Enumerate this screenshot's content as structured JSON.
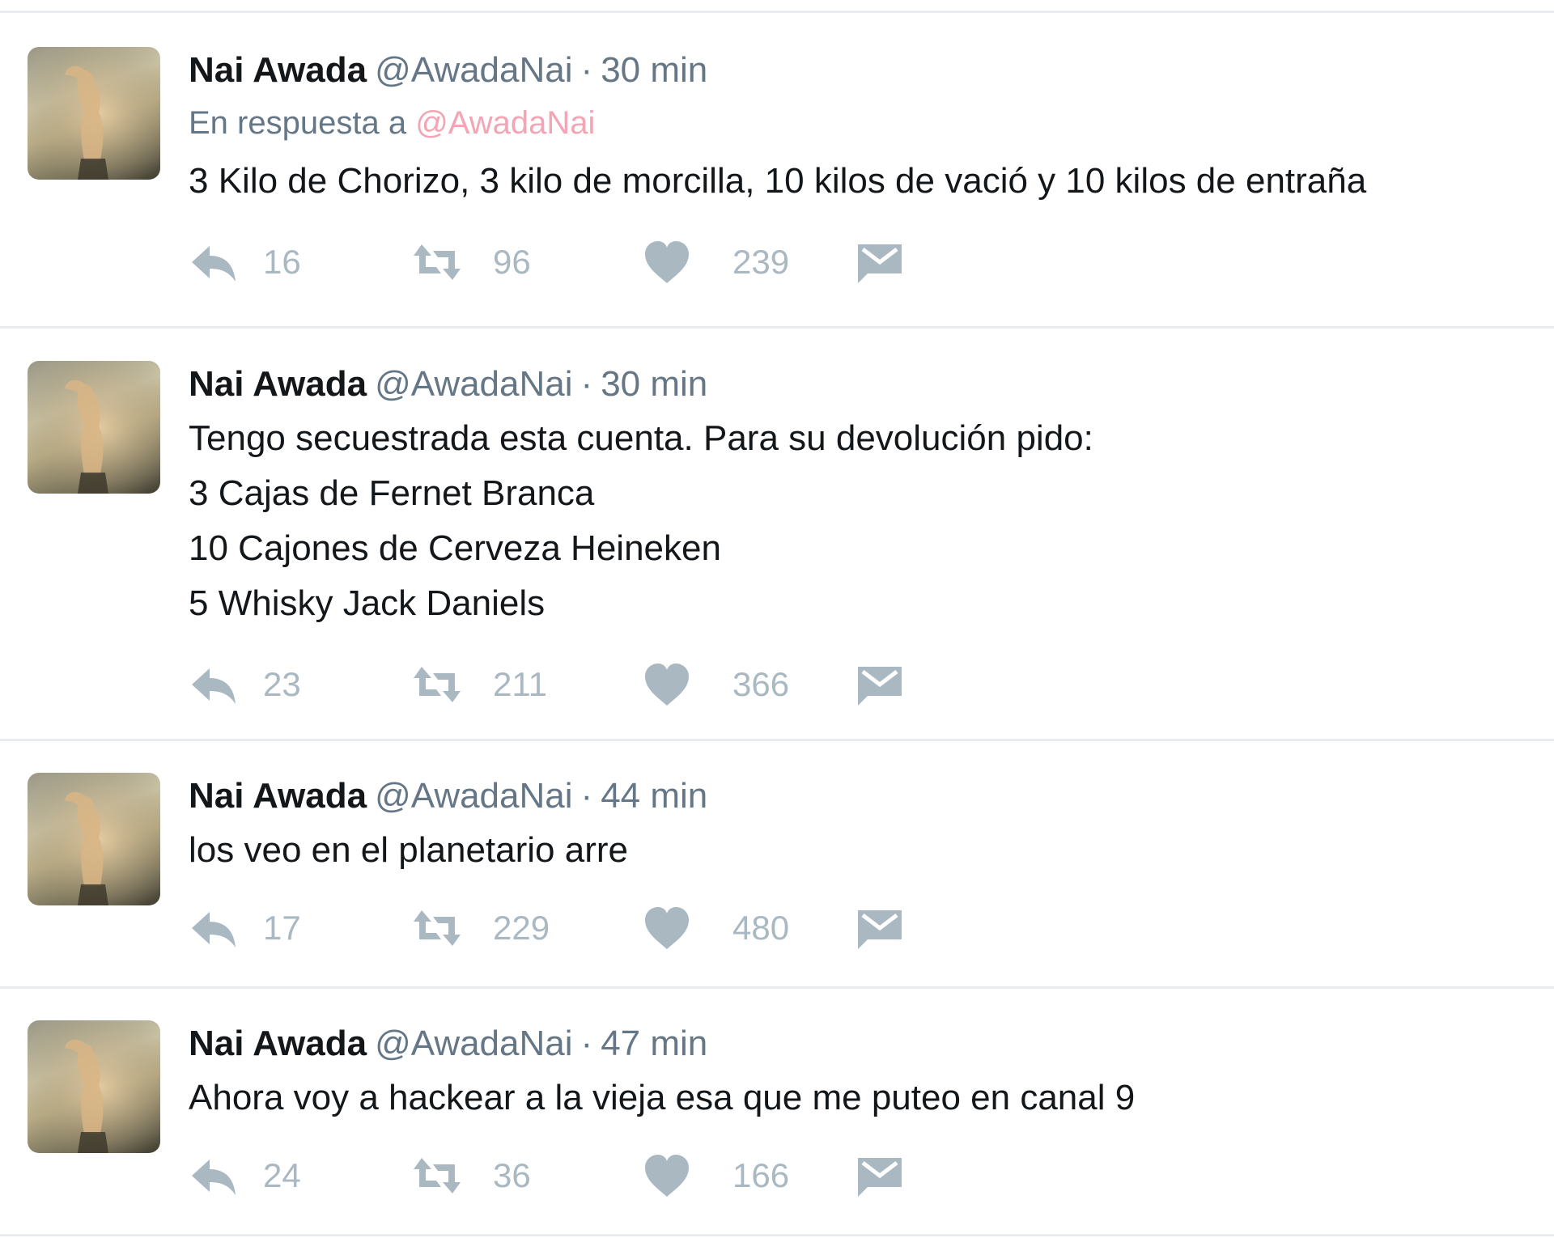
{
  "colors": {
    "name": "#14171a",
    "meta": "#657786",
    "mention": "#f3a5b5",
    "action_icon": "#aab8c2",
    "divider": "#e6ecf0"
  },
  "icons": {
    "reply": "reply-arrow-icon",
    "retweet": "retweet-icon",
    "like": "heart-icon",
    "dm": "envelope-icon"
  },
  "tweets": [
    {
      "fullname": "Nai Awada",
      "username": "@AwadaNai",
      "separator": "·",
      "time": "30 min",
      "reply_prefix": "En respuesta a",
      "reply_mention": "@AwadaNai",
      "lines": [
        "3 Kilo de Chorizo, 3 kilo de morcilla, 10 kilos de vació y 10 kilos de entraña"
      ],
      "replies": "16",
      "retweets": "96",
      "likes": "239"
    },
    {
      "fullname": "Nai Awada",
      "username": "@AwadaNai",
      "separator": "·",
      "time": "30 min",
      "lines": [
        "Tengo secuestrada esta cuenta. Para su devolución pido:",
        "3 Cajas de Fernet Branca",
        "10 Cajones de Cerveza Heineken",
        "5 Whisky Jack Daniels"
      ],
      "replies": "23",
      "retweets": "211",
      "likes": "366"
    },
    {
      "fullname": "Nai Awada",
      "username": "@AwadaNai",
      "separator": "·",
      "time": "44 min",
      "lines": [
        "los veo en el planetario arre"
      ],
      "replies": "17",
      "retweets": "229",
      "likes": "480"
    },
    {
      "fullname": "Nai Awada",
      "username": "@AwadaNai",
      "separator": "·",
      "time": "47 min",
      "lines": [
        "Ahora voy a hackear a la vieja esa que me puteo en canal 9"
      ],
      "replies": "24",
      "retweets": "36",
      "likes": "166"
    }
  ]
}
